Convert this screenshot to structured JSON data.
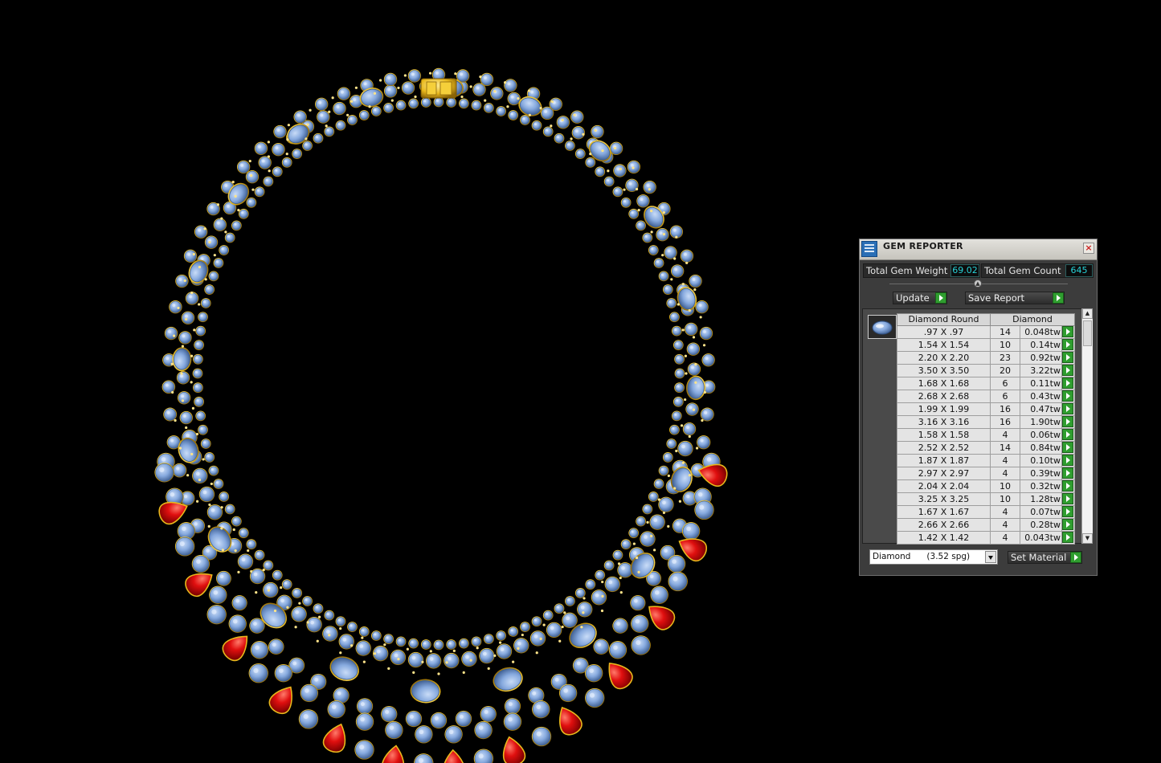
{
  "panel": {
    "title": "GEM REPORTER",
    "close_label": "×",
    "total_weight_label": "Total Gem Weight",
    "total_weight_value": "69.02",
    "total_count_label": "Total Gem Count",
    "total_count_value": "645",
    "update_label": "Update",
    "save_report_label": "Save Report",
    "table": {
      "header_shape": "Diamond Round",
      "header_material": "Diamond",
      "rows": [
        {
          "size": ".97 X .97",
          "count": "14",
          "weight": "0.048tw"
        },
        {
          "size": "1.54 X 1.54",
          "count": "10",
          "weight": "0.14tw"
        },
        {
          "size": "2.20 X 2.20",
          "count": "23",
          "weight": "0.92tw"
        },
        {
          "size": "3.50 X 3.50",
          "count": "20",
          "weight": "3.22tw"
        },
        {
          "size": "1.68 X 1.68",
          "count": "6",
          "weight": "0.11tw"
        },
        {
          "size": "2.68 X 2.68",
          "count": "6",
          "weight": "0.43tw"
        },
        {
          "size": "1.99 X 1.99",
          "count": "16",
          "weight": "0.47tw"
        },
        {
          "size": "3.16 X 3.16",
          "count": "16",
          "weight": "1.90tw"
        },
        {
          "size": "1.58 X 1.58",
          "count": "4",
          "weight": "0.06tw"
        },
        {
          "size": "2.52 X 2.52",
          "count": "14",
          "weight": "0.84tw"
        },
        {
          "size": "1.87 X 1.87",
          "count": "4",
          "weight": "0.10tw"
        },
        {
          "size": "2.97 X 2.97",
          "count": "4",
          "weight": "0.39tw"
        },
        {
          "size": "2.04 X 2.04",
          "count": "10",
          "weight": "0.32tw"
        },
        {
          "size": "3.25 X 3.25",
          "count": "10",
          "weight": "1.28tw"
        },
        {
          "size": "1.67 X 1.67",
          "count": "4",
          "weight": "0.07tw"
        },
        {
          "size": "2.66 X 2.66",
          "count": "4",
          "weight": "0.28tw"
        },
        {
          "size": "1.42 X 1.42",
          "count": "4",
          "weight": "0.043tw"
        }
      ]
    },
    "material_select": "Diamond      (3.52 spg)",
    "set_material_label": "Set Material"
  },
  "colors": {
    "background": "#000000",
    "gem_blue": "#7fa5dc",
    "ruby_red": "#d40a0a",
    "gold": "#e8b81c",
    "value_cyan": "#27d3d8",
    "go_green": "#2f9e2f"
  }
}
